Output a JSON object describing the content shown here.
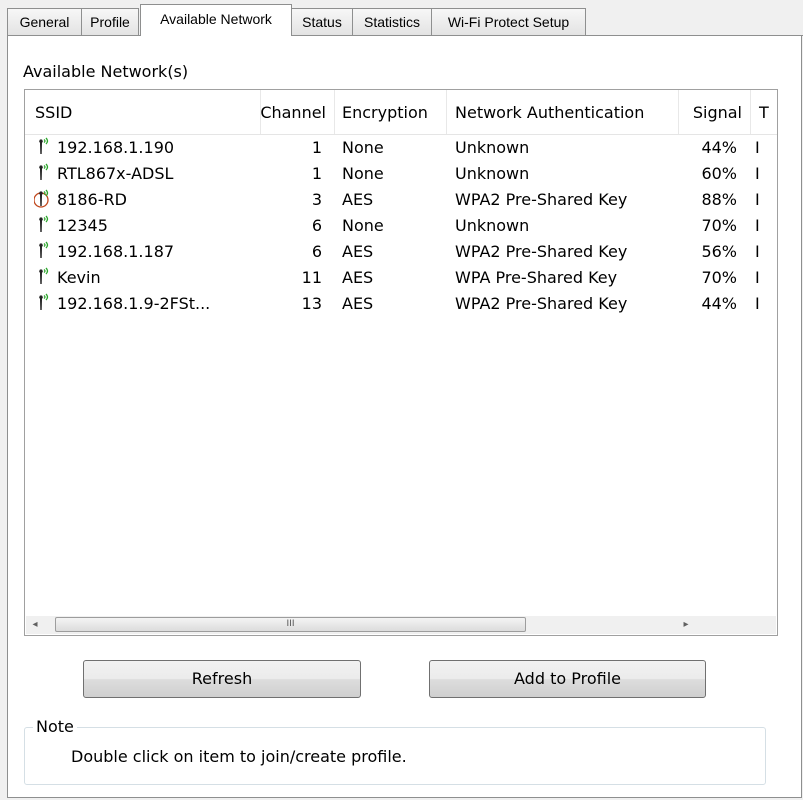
{
  "tabs": [
    {
      "label": "General",
      "active": false
    },
    {
      "label": "Profile",
      "active": false
    },
    {
      "label": "Available Network",
      "active": true
    },
    {
      "label": "Status",
      "active": false
    },
    {
      "label": "Statistics",
      "active": false
    },
    {
      "label": "Wi-Fi Protect Setup",
      "active": false
    }
  ],
  "group_label": "Available Network(s)",
  "table": {
    "columns": [
      "SSID",
      "Channel",
      "Encryption",
      "Network Authentication",
      "Signal",
      "T"
    ],
    "rows": [
      {
        "ssid": "192.168.1.190",
        "channel": "1",
        "encryption": "None",
        "auth": "Unknown",
        "signal": "44%",
        "type": "I",
        "connected": false
      },
      {
        "ssid": "RTL867x-ADSL",
        "channel": "1",
        "encryption": "None",
        "auth": "Unknown",
        "signal": "60%",
        "type": "I",
        "connected": false
      },
      {
        "ssid": "8186-RD",
        "channel": "3",
        "encryption": "AES",
        "auth": "WPA2 Pre-Shared Key",
        "signal": "88%",
        "type": "I",
        "connected": true
      },
      {
        "ssid": "12345",
        "channel": "6",
        "encryption": "None",
        "auth": "Unknown",
        "signal": "70%",
        "type": "I",
        "connected": false
      },
      {
        "ssid": "192.168.1.187",
        "channel": "6",
        "encryption": "AES",
        "auth": "WPA2 Pre-Shared Key",
        "signal": "56%",
        "type": "I",
        "connected": false
      },
      {
        "ssid": "Kevin",
        "channel": "11",
        "encryption": "AES",
        "auth": "WPA Pre-Shared Key",
        "signal": "70%",
        "type": "I",
        "connected": false
      },
      {
        "ssid": "192.168.1.9-2FSt...",
        "channel": "13",
        "encryption": "AES",
        "auth": "WPA2 Pre-Shared Key",
        "signal": "44%",
        "type": "I",
        "connected": false
      }
    ]
  },
  "scrollbar": {
    "left_arrow": "◂",
    "right_arrow": "▸",
    "thumb_grip": "III"
  },
  "buttons": {
    "refresh": "Refresh",
    "add_to_profile": "Add to Profile"
  },
  "note": {
    "label": "Note",
    "text": "Double click on item to join/create profile."
  },
  "icons": {
    "network": "wireless-antenna-icon"
  },
  "colors": {
    "signal_wave": "#2aa52a",
    "connected_ring": "#c0471c",
    "tab_border": "#8e8f8f"
  }
}
